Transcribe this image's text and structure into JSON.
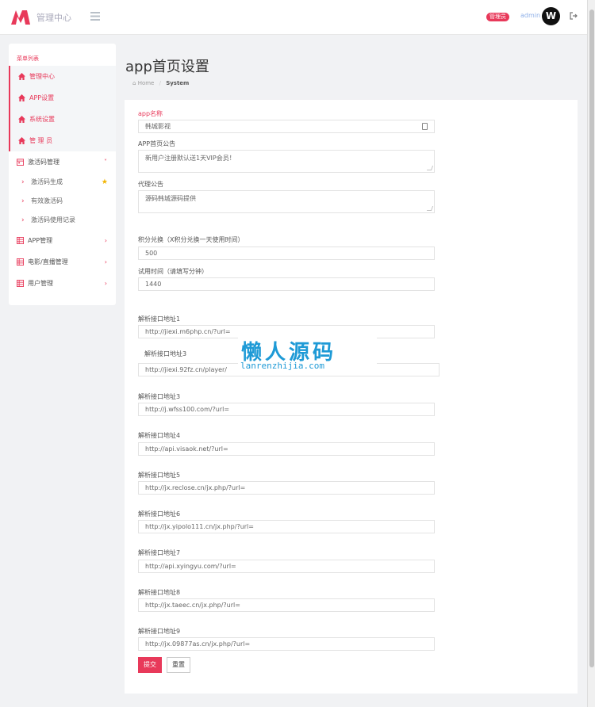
{
  "header": {
    "brand": "管理中心",
    "role_badge": "管理员",
    "username": "admin",
    "avatar_letter": "W"
  },
  "sidebar": {
    "heading": "菜单列表",
    "items": [
      {
        "label": "管理中心",
        "icon": "home-icon",
        "style": "pink"
      },
      {
        "label": "APP设置",
        "icon": "home-icon",
        "style": "pink"
      },
      {
        "label": "系统设置",
        "icon": "home-icon",
        "style": "pink"
      },
      {
        "label": "管 理 员",
        "icon": "home-icon",
        "style": "pink"
      },
      {
        "label": "激活码管理",
        "icon": "calendar-icon",
        "style": "normal",
        "chevron": "˅"
      }
    ],
    "sub_items": [
      {
        "label": "激活码生成",
        "starred": true
      },
      {
        "label": "有效激活码"
      },
      {
        "label": "激活码使用记录"
      }
    ],
    "bottom_items": [
      {
        "label": "APP管理",
        "icon": "grid-icon",
        "chevron": "›"
      },
      {
        "label": "电影/直播管理",
        "icon": "grid-icon",
        "chevron": "›"
      },
      {
        "label": "用户管理",
        "icon": "grid-icon",
        "chevron": "›"
      }
    ]
  },
  "page": {
    "title": "app首页设置",
    "breadcrumb_home": "Home",
    "breadcrumb_sep": "/",
    "breadcrumb_current": "System"
  },
  "form": {
    "app_name": {
      "label": "app名称",
      "value": "韩城影视"
    },
    "notice": {
      "label": "APP首页公告",
      "value": "新用户注册默认送1天VIP会员！"
    },
    "agent_notice": {
      "label": "代理公告",
      "value": "源码韩城源码提供"
    },
    "points": {
      "label": "积分兑换（X积分兑换一天使用时间）",
      "value": "500"
    },
    "trial": {
      "label": "试用时间（请填写分钟）",
      "value": "1440"
    },
    "parsers": [
      {
        "label": "解析接口地址1",
        "value": "http://jiexi.m6php.cn/?url="
      },
      {
        "label": "解析接口地址3",
        "value": "http://jiexi.92fz.cn/player/"
      },
      {
        "label": "解析接口地址3",
        "value": "http://j.wfss100.com/?url="
      },
      {
        "label": "解析接口地址4",
        "value": "http://api.visaok.net/?url="
      },
      {
        "label": "解析接口地址5",
        "value": "http://jx.reclose.cn/jx.php/?url="
      },
      {
        "label": "解析接口地址6",
        "value": "http://jx.yipolo111.cn/jx.php/?url="
      },
      {
        "label": "解析接口地址7",
        "value": "http://api.xyingyu.com/?url="
      },
      {
        "label": "解析接口地址8",
        "value": "http://jx.taeec.cn/jx.php/?url="
      },
      {
        "label": "解析接口地址9",
        "value": "http://jx.09877as.cn/jx.php/?url="
      }
    ],
    "submit_label": "提交",
    "reset_label": "重置"
  },
  "watermark": {
    "cn": "懒人源码",
    "en": "lanrenzhijia.com"
  },
  "colors": {
    "accent": "#e8395a",
    "watermark": "#1e9ad6"
  }
}
